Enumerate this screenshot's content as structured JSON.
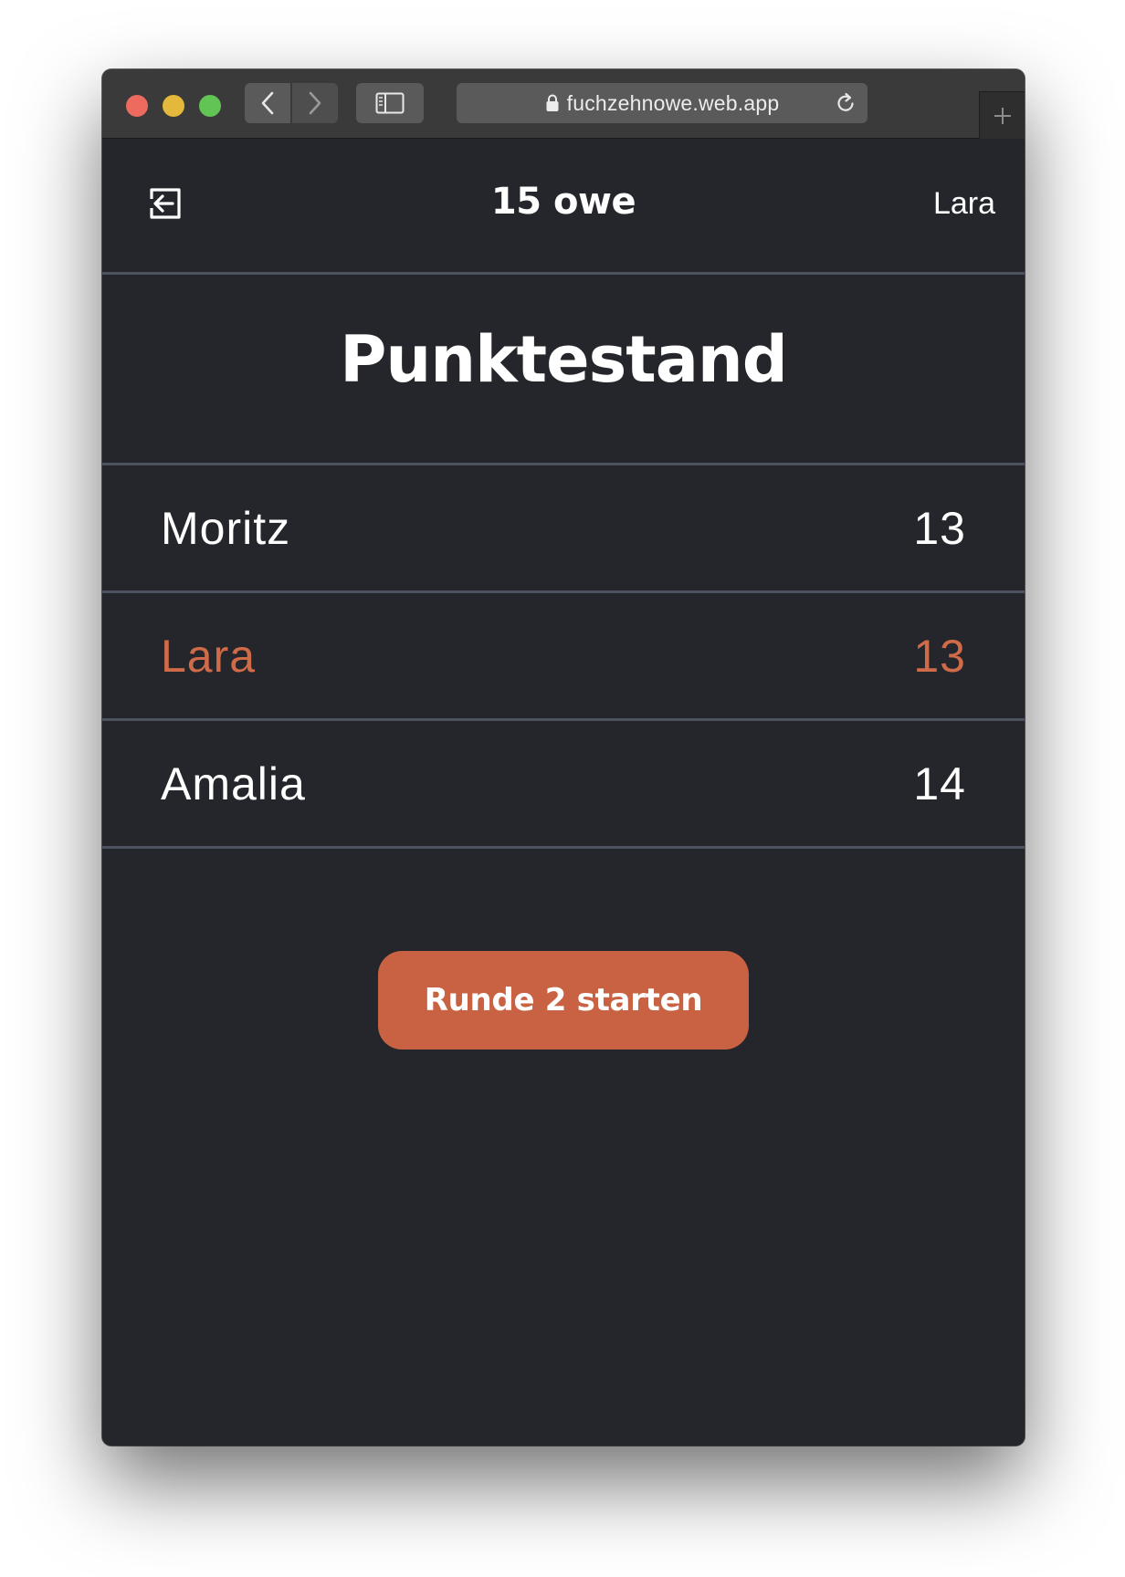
{
  "browser": {
    "url": "fuchzehnowe.web.app",
    "icons": {
      "back": "chevron-left-icon",
      "forward": "chevron-right-icon",
      "sidebar": "sidebar-icon",
      "lock": "lock-icon",
      "reload": "reload-icon",
      "new_tab": "plus-icon"
    }
  },
  "header": {
    "title": "15 owe",
    "username": "Lara",
    "exit_icon": "exit-icon"
  },
  "scoreboard": {
    "heading": "Punktestand",
    "rows": [
      {
        "name": "Moritz",
        "score": "13",
        "is_current_user": false
      },
      {
        "name": "Lara",
        "score": "13",
        "is_current_user": true
      },
      {
        "name": "Amalia",
        "score": "14",
        "is_current_user": false
      }
    ]
  },
  "actions": {
    "start_round_label": "Runde 2 starten"
  },
  "colors": {
    "background": "#24262b",
    "divider": "#4c5260",
    "accent": "#c86242",
    "current_user_text": "#d06b4a",
    "text": "#ffffff"
  }
}
